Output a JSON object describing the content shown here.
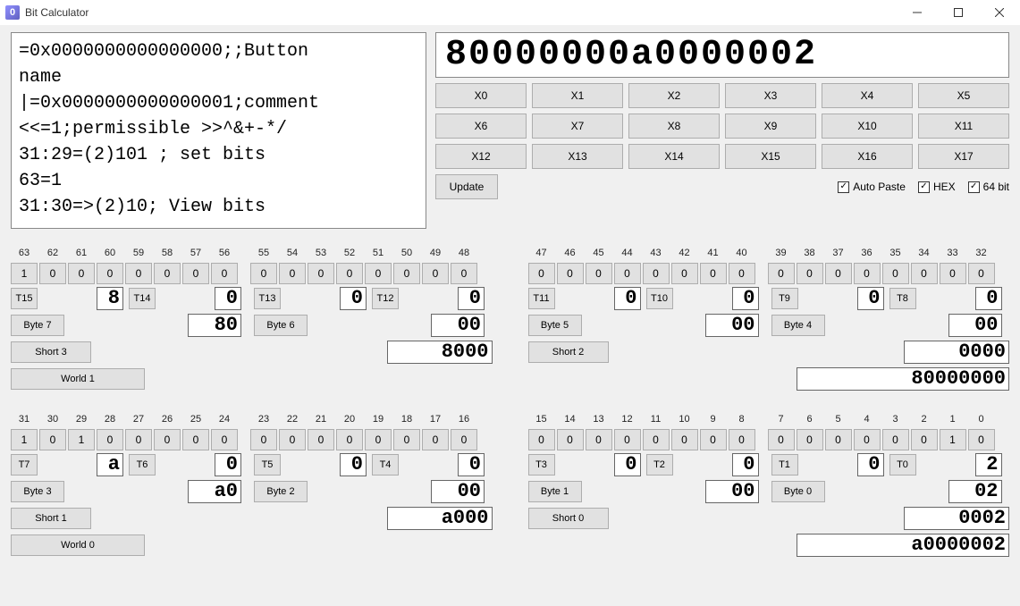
{
  "window": {
    "title": "Bit Calculator",
    "icon_glyph": "0"
  },
  "script": "=0x0000000000000000;;Button\nname\n|=0x0000000000000001;comment\n<<=1;permissible >>^&+-*/\n31:29=(2)101 ; set bits\n63=1\n31:30=>(2)10; View bits",
  "display_value": "80000000a0000002",
  "x_buttons": [
    "X0",
    "X1",
    "X2",
    "X3",
    "X4",
    "X5",
    "X6",
    "X7",
    "X8",
    "X9",
    "X10",
    "X11",
    "X12",
    "X13",
    "X14",
    "X15",
    "X16",
    "X17"
  ],
  "update_label": "Update",
  "checks": {
    "auto_paste": "Auto Paste",
    "hex": "HEX",
    "bit64": "64 bit"
  },
  "upper": {
    "left": {
      "bit_labels": [
        "63",
        "62",
        "61",
        "60",
        "59",
        "58",
        "57",
        "56",
        "55",
        "54",
        "53",
        "52",
        "51",
        "50",
        "49",
        "48"
      ],
      "bit_values": [
        "1",
        "0",
        "0",
        "0",
        "0",
        "0",
        "0",
        "0",
        "0",
        "0",
        "0",
        "0",
        "0",
        "0",
        "0",
        "0"
      ],
      "t_left1": "T15",
      "nib_left1": "8",
      "t_left2": "T14",
      "nib_left2": "0",
      "t_right1": "T13",
      "nib_right1": "0",
      "t_right2": "T12",
      "nib_right2": "0",
      "byte_left_btn": "Byte 7",
      "byte_left_val": "80",
      "byte_right_btn": "Byte 6",
      "byte_right_val": "00",
      "short_btn": "Short 3",
      "short_val": "8000",
      "world_btn": "World 1"
    },
    "right": {
      "bit_labels": [
        "47",
        "46",
        "45",
        "44",
        "43",
        "42",
        "41",
        "40",
        "39",
        "38",
        "37",
        "36",
        "35",
        "34",
        "33",
        "32"
      ],
      "bit_values": [
        "0",
        "0",
        "0",
        "0",
        "0",
        "0",
        "0",
        "0",
        "0",
        "0",
        "0",
        "0",
        "0",
        "0",
        "0",
        "0"
      ],
      "t_left1": "T11",
      "nib_left1": "0",
      "t_left2": "T10",
      "nib_left2": "0",
      "t_right1": "T9",
      "nib_right1": "0",
      "t_right2": "T8",
      "nib_right2": "0",
      "byte_left_btn": "Byte 5",
      "byte_left_val": "00",
      "byte_right_btn": "Byte 4",
      "byte_right_val": "00",
      "short_btn": "Short 2",
      "short_val": "0000",
      "world_val": "80000000"
    }
  },
  "lower": {
    "left": {
      "bit_labels": [
        "31",
        "30",
        "29",
        "28",
        "27",
        "26",
        "25",
        "24",
        "23",
        "22",
        "21",
        "20",
        "19",
        "18",
        "17",
        "16"
      ],
      "bit_values": [
        "1",
        "0",
        "1",
        "0",
        "0",
        "0",
        "0",
        "0",
        "0",
        "0",
        "0",
        "0",
        "0",
        "0",
        "0",
        "0"
      ],
      "t_left1": "T7",
      "nib_left1": "a",
      "t_left2": "T6",
      "nib_left2": "0",
      "t_right1": "T5",
      "nib_right1": "0",
      "t_right2": "T4",
      "nib_right2": "0",
      "byte_left_btn": "Byte 3",
      "byte_left_val": "a0",
      "byte_right_btn": "Byte 2",
      "byte_right_val": "00",
      "short_btn": "Short 1",
      "short_val": "a000",
      "world_btn": "World 0"
    },
    "right": {
      "bit_labels": [
        "15",
        "14",
        "13",
        "12",
        "11",
        "10",
        "9",
        "8",
        "7",
        "6",
        "5",
        "4",
        "3",
        "2",
        "1",
        "0"
      ],
      "bit_values": [
        "0",
        "0",
        "0",
        "0",
        "0",
        "0",
        "0",
        "0",
        "0",
        "0",
        "0",
        "0",
        "0",
        "0",
        "1",
        "0"
      ],
      "t_left1": "T3",
      "nib_left1": "0",
      "t_left2": "T2",
      "nib_left2": "0",
      "t_right1": "T1",
      "nib_right1": "0",
      "t_right2": "T0",
      "nib_right2": "2",
      "byte_left_btn": "Byte 1",
      "byte_left_val": "00",
      "byte_right_btn": "Byte 0",
      "byte_right_val": "02",
      "short_btn": "Short 0",
      "short_val": "0002",
      "world_val": "a0000002"
    }
  }
}
